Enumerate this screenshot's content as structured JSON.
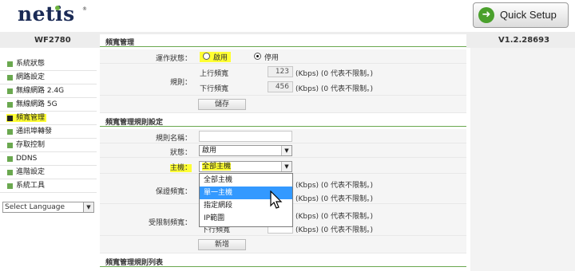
{
  "header": {
    "logo": "netis",
    "registered": "®",
    "quick_setup": "Quick Setup",
    "quick_setup_icon": "arrow-circle-icon"
  },
  "device": {
    "model": "WF2780",
    "version": "V1.2.28693"
  },
  "sidebar": {
    "items": [
      {
        "label": "系統狀態"
      },
      {
        "label": "網路設定"
      },
      {
        "label": "無線網路 2.4G"
      },
      {
        "label": "無線網路 5G"
      },
      {
        "label": "頻寬管理"
      },
      {
        "label": "通訊埠轉發"
      },
      {
        "label": "存取控制"
      },
      {
        "label": "DDNS"
      },
      {
        "label": "進階設定"
      },
      {
        "label": "系統工具"
      }
    ],
    "language": "Select Language"
  },
  "bandwidth": {
    "title": "頻寬管理",
    "status_label": "運作狀態：",
    "enable_label": "啟用",
    "disable_label": "停用",
    "rule_label": "規則：",
    "upload_label": "上行頻寬",
    "upload_value": "123",
    "upload_hint": "(Kbps) (0 代表不限制。)",
    "download_label": "下行頻寬",
    "download_value": "456",
    "download_hint": "(Kbps) (0 代表不限制。)",
    "save_button": "儲存"
  },
  "rule_settings": {
    "title": "頻寬管理規則設定",
    "name_label": "規則名稱：",
    "name_value": "",
    "status_label": "狀態：",
    "status_value": "啟用",
    "host_label": "主機：",
    "host_value": "全部主機",
    "host_options": [
      "全部主機",
      "單一主機",
      "指定網段",
      "IP範圍"
    ],
    "guaranteed_label": "保證頻寬：",
    "guaranteed_hint_up": "(Kbps) (0 代表不限制。)",
    "guaranteed_hint_down": "(Kbps) (0 代表不限制。)",
    "limit_label": "受限制頻寬：",
    "limit_hint_up": "(Kbps) (0 代表不限制。)",
    "limit_hint_down": "(Kbps) (0 代表不限制。)",
    "limit_down_label": "下行頻寬",
    "add_button": "新增"
  },
  "rule_list": {
    "title": "頻寬管理規則列表"
  }
}
